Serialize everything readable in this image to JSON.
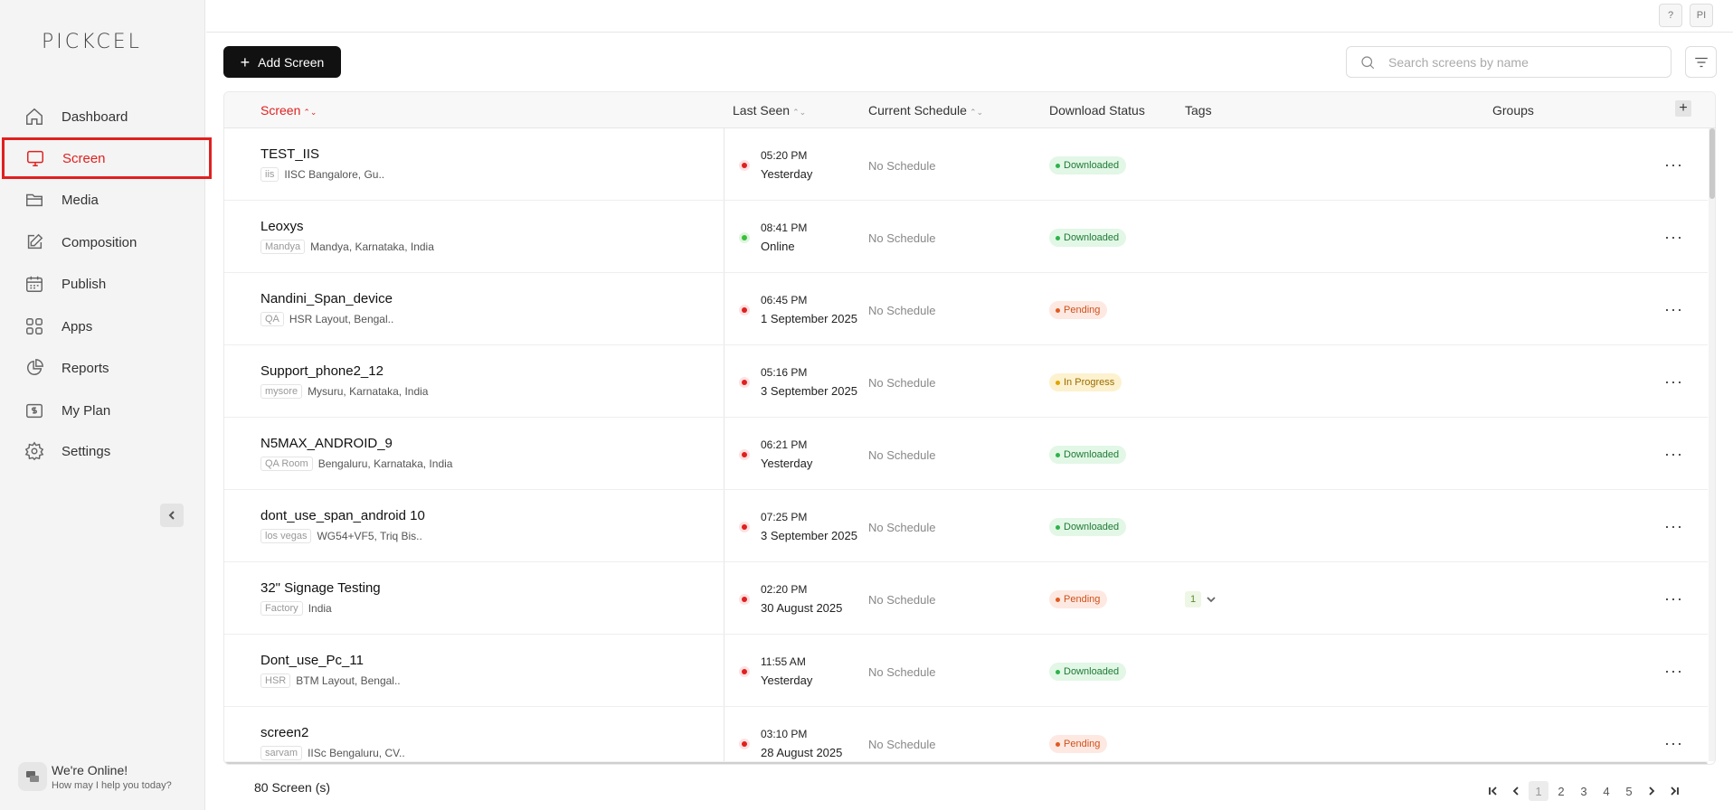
{
  "app": {
    "logo_text": "PICKCEL"
  },
  "sidebar": {
    "items": [
      {
        "label": "Dashboard",
        "icon": "home-icon"
      },
      {
        "label": "Screen",
        "icon": "monitor-icon",
        "active": true
      },
      {
        "label": "Media",
        "icon": "folder-icon"
      },
      {
        "label": "Composition",
        "icon": "edit-icon"
      },
      {
        "label": "Publish",
        "icon": "calendar-icon"
      },
      {
        "label": "Apps",
        "icon": "grid-icon"
      },
      {
        "label": "Reports",
        "icon": "pie-chart-icon"
      },
      {
        "label": "My Plan",
        "icon": "plan-icon"
      },
      {
        "label": "Settings",
        "icon": "gear-icon"
      }
    ],
    "chat": {
      "title": "We're Online!",
      "subtitle": "How may I help you today?"
    }
  },
  "header": {
    "help_label": "?",
    "avatar_label": "PI"
  },
  "toolbar": {
    "add_label": "Add Screen",
    "search_placeholder": "Search screens by name"
  },
  "table": {
    "columns": {
      "screen": "Screen",
      "last_seen": "Last Seen",
      "current_schedule": "Current Schedule",
      "download_status": "Download Status",
      "tags": "Tags",
      "groups": "Groups"
    },
    "sort_glyph": "⌃⌄",
    "rows": [
      {
        "name": "TEST_IIS",
        "tag": "iis",
        "location": "IISC Bangalore, Gu..",
        "time": "05:20 PM",
        "date": "Yesterday",
        "status_kind": "offline",
        "schedule": "No Schedule",
        "download": "Downloaded",
        "download_kind": "downloaded",
        "tags": ""
      },
      {
        "name": "Leoxys",
        "tag": "Mandya",
        "location": "Mandya, Karnataka, India",
        "time": "08:41 PM",
        "date": "Online",
        "status_kind": "online",
        "schedule": "No Schedule",
        "download": "Downloaded",
        "download_kind": "downloaded",
        "tags": ""
      },
      {
        "name": "Nandini_Span_device",
        "tag": "QA",
        "location": "HSR Layout, Bengal..",
        "time": "06:45 PM",
        "date": "1 September 2025",
        "status_kind": "offline",
        "schedule": "No Schedule",
        "download": "Pending",
        "download_kind": "pending",
        "tags": ""
      },
      {
        "name": "Support_phone2_12",
        "tag": "mysore",
        "location": "Mysuru, Karnataka, India",
        "time": "05:16 PM",
        "date": "3 September 2025",
        "status_kind": "offline",
        "schedule": "No Schedule",
        "download": "In Progress",
        "download_kind": "progress",
        "tags": ""
      },
      {
        "name": "N5MAX_ANDROID_9",
        "tag": "QA Room",
        "location": "Bengaluru, Karnataka, India",
        "time": "06:21 PM",
        "date": "Yesterday",
        "status_kind": "offline",
        "schedule": "No Schedule",
        "download": "Downloaded",
        "download_kind": "downloaded",
        "tags": ""
      },
      {
        "name": "dont_use_span_android 10",
        "tag": "los vegas",
        "location": "WG54+VF5, Triq Bis..",
        "time": "07:25 PM",
        "date": "3 September 2025",
        "status_kind": "offline",
        "schedule": "No Schedule",
        "download": "Downloaded",
        "download_kind": "downloaded",
        "tags": ""
      },
      {
        "name": "32\" Signage Testing",
        "tag": "Factory",
        "location": "India",
        "time": "02:20 PM",
        "date": "30 August 2025",
        "status_kind": "offline",
        "schedule": "No Schedule",
        "download": "Pending",
        "download_kind": "pending",
        "tags": "1"
      },
      {
        "name": "Dont_use_Pc_11",
        "tag": "HSR",
        "location": "BTM Layout, Bengal..",
        "time": "11:55 AM",
        "date": "Yesterday",
        "status_kind": "offline",
        "schedule": "No Schedule",
        "download": "Downloaded",
        "download_kind": "downloaded",
        "tags": ""
      },
      {
        "name": "screen2",
        "tag": "sarvam",
        "location": "IISc Bengaluru, CV..",
        "time": "03:10 PM",
        "date": "28 August 2025",
        "status_kind": "offline",
        "schedule": "No Schedule",
        "download": "Pending",
        "download_kind": "pending",
        "tags": ""
      }
    ],
    "more_glyph": "···"
  },
  "footer": {
    "count_label": "80 Screen (s)",
    "pages": [
      "1",
      "2",
      "3",
      "4",
      "5"
    ],
    "current_page": "1"
  },
  "colors": {
    "accent": "#e02020",
    "downloaded": "#2fb24c",
    "pending": "#e25a20",
    "in_progress": "#e0a400",
    "online": "#3cbf3c"
  }
}
